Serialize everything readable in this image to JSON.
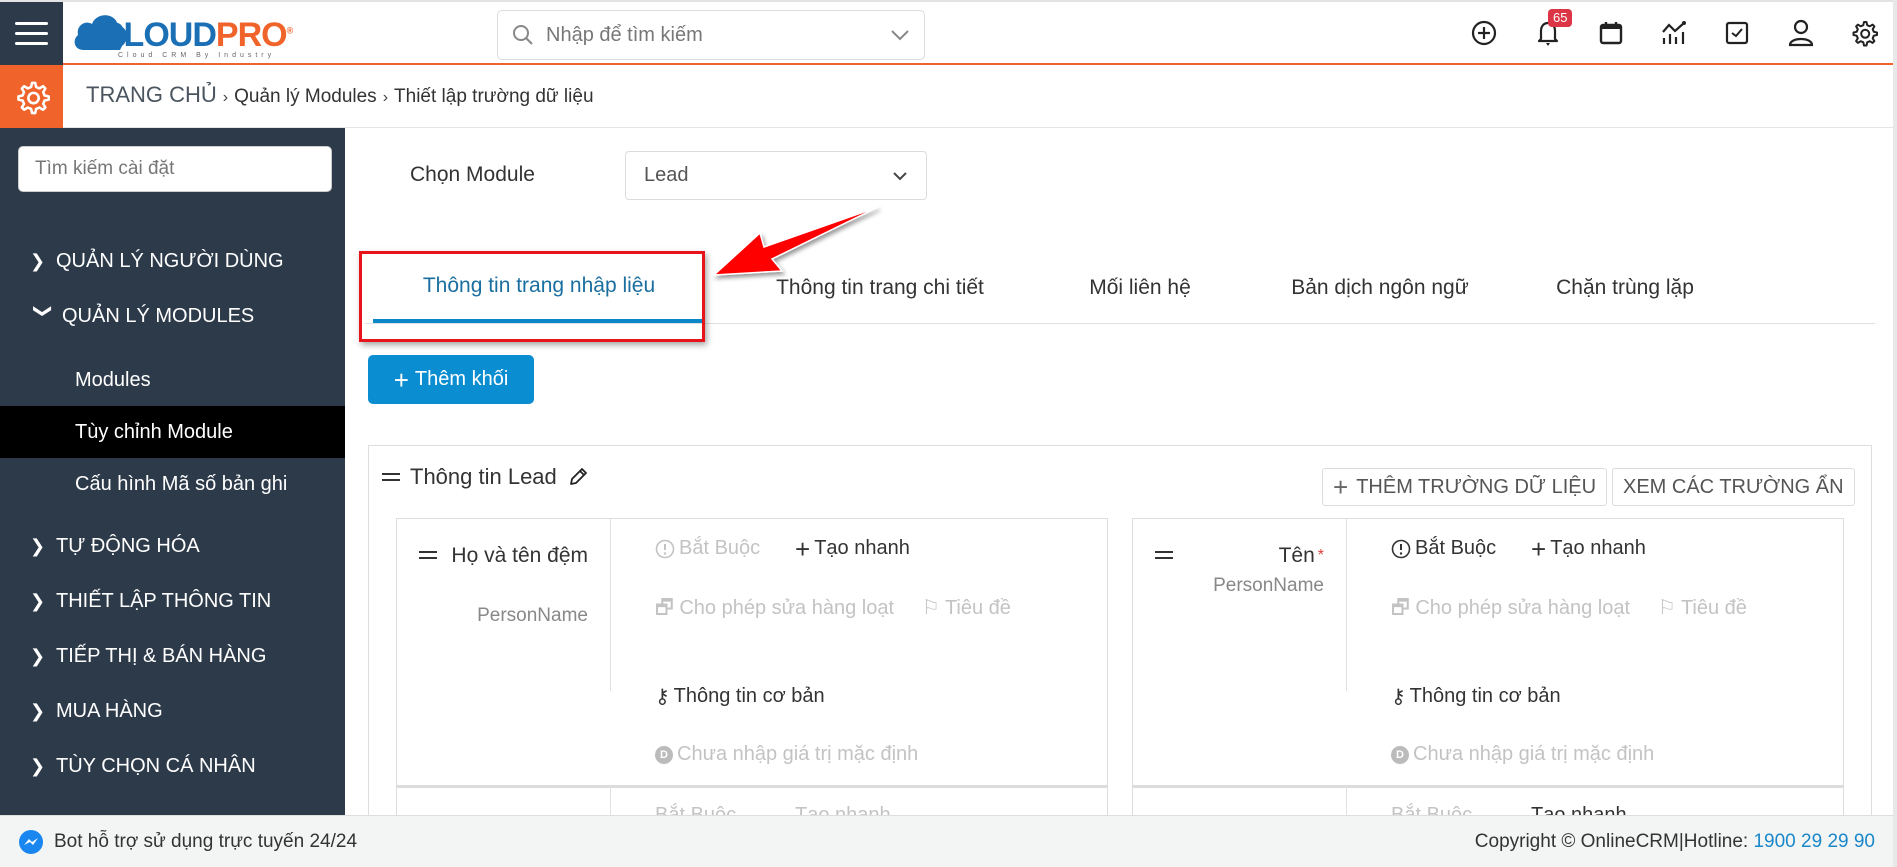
{
  "header": {
    "logo": {
      "brand_part1": "CLOUD",
      "brand_part2": "PRO",
      "registered": "®",
      "tagline": "Cloud CRM By Industry"
    },
    "search": {
      "placeholder": "Nhập để tìm kiếm"
    },
    "icons": [
      "plus-circle-icon",
      "bell-icon",
      "calendar-icon",
      "chart-icon",
      "checkbox-icon",
      "user-icon",
      "gear-icon"
    ],
    "notification_count": "65",
    "colors": {
      "accent": "#f0642c",
      "primary": "#0b8ed1",
      "sidebar": "#2d3a4a",
      "badge": "#dc3545"
    }
  },
  "breadcrumb": {
    "items": [
      "TRANG CHỦ",
      "Quản lý Modules",
      "Thiết lập trường dữ liệu"
    ],
    "separator": "›"
  },
  "sidebar": {
    "search_placeholder": "Tìm kiếm cài đặt",
    "groups": [
      {
        "label": "QUẢN LÝ NGƯỜI DÙNG",
        "expanded": false
      },
      {
        "label": "QUẢN LÝ MODULES",
        "expanded": true,
        "children": [
          {
            "label": "Modules",
            "active": false
          },
          {
            "label": "Tùy chỉnh Module",
            "active": true
          },
          {
            "label": "Cấu hình Mã số bản ghi",
            "active": false
          }
        ]
      },
      {
        "label": "TỰ ĐỘNG HÓA",
        "expanded": false
      },
      {
        "label": "THIẾT LẬP THÔNG TIN",
        "expanded": false
      },
      {
        "label": "TIẾP THỊ & BÁN HÀNG",
        "expanded": false
      },
      {
        "label": "MUA HÀNG",
        "expanded": false
      },
      {
        "label": "TÙY CHỌN CÁ NHÂN",
        "expanded": false
      }
    ]
  },
  "main": {
    "module_label": "Chọn Module",
    "module_selected": "Lead",
    "tabs": [
      {
        "label": "Thông tin trang nhập liệu",
        "active": true
      },
      {
        "label": "Thông tin trang chi tiết",
        "active": false
      },
      {
        "label": "Mối liên hệ",
        "active": false
      },
      {
        "label": "Bản dịch ngôn ngữ",
        "active": false
      },
      {
        "label": "Chặn trùng lặp",
        "active": false
      }
    ],
    "add_block_label": "Thêm khối",
    "block": {
      "title": "Thông tin Lead",
      "add_field_label": "THÊM TRƯỜNG DỮ LIỆU",
      "view_hidden_label": "XEM CÁC TRƯỜNG ẨN",
      "fields": [
        {
          "name": "Họ và tên đệm",
          "type": "PersonName",
          "required": false,
          "opt_required": "Bắt Buộc",
          "opt_quick_create": "Tạo nhanh",
          "opt_mass_edit": "Cho phép sửa hàng loạt",
          "opt_header": "Tiêu đề",
          "opt_key_field": "Thông tin cơ bản",
          "opt_default": "Chưa nhập giá trị mặc định"
        },
        {
          "name": "Tên",
          "required_mark": "*",
          "type": "PersonName",
          "required": true,
          "opt_required": "Bắt Buộc",
          "opt_quick_create": "Tạo nhanh",
          "opt_mass_edit": "Cho phép sửa hàng loạt",
          "opt_header": "Tiêu đề",
          "opt_key_field": "Thông tin cơ bản",
          "opt_default": "Chưa nhập giá trị mặc định"
        }
      ],
      "next_row": {
        "opt_required": "Bắt Buộc",
        "opt_quick_create": "Tạo nhanh"
      }
    }
  },
  "footer": {
    "bot_text": "Bot hỗ trợ sử dụng trực tuyến 24/24",
    "copyright": "Copyright © OnlineCRM|Hotline: ",
    "hotline": "1900 29 29 90"
  }
}
